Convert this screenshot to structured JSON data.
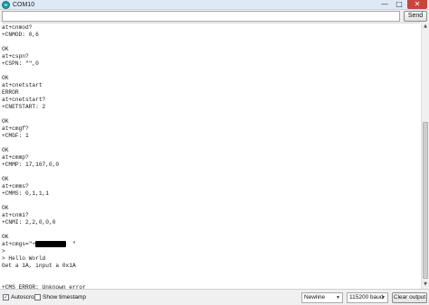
{
  "window": {
    "title": "COM10",
    "minimize_glyph": "—",
    "maximize_glyph": "□",
    "close_glyph": "✕"
  },
  "input": {
    "value": "",
    "send_label": "Send"
  },
  "output": {
    "lines": [
      "at+cnmod?",
      "+CNMOD: 0,6",
      "",
      "OK",
      "at+cspn?",
      "+CSPN: \"\",0",
      "",
      "OK",
      "at+cnetstart",
      "ERROR",
      "at+cnetstart?",
      "+CNETSTART: 2",
      "",
      "OK",
      "at+cmgf?",
      "+CMGF: 1",
      "",
      "OK",
      "at+cmmp?",
      "+CMMP: 17,167,0,0",
      "",
      "OK",
      "at+cmms?",
      "+CMMS: 0,1,1,1",
      "",
      "OK",
      "at+cnmi?",
      "+CNMI: 2,2,0,0,0",
      "",
      "OK",
      "at+cmgs=\"+1          \"",
      ">",
      "> Hello World",
      "Get a 1A, input a 0x1A",
      "",
      "",
      "+CMS ERROR: Unknown error"
    ]
  },
  "bottom": {
    "autoscroll_label": "Autoscroll",
    "autoscroll_checked": true,
    "timestamp_label": "Show timestamp",
    "timestamp_checked": false,
    "line_ending": "Newline",
    "baud": "115200 baud",
    "clear_label": "Clear output"
  },
  "icons": {
    "app": "arduino-icon",
    "scroll_up": "scroll-up-arrow-icon",
    "scroll_down": "scroll-down-arrow-icon",
    "dropdown": "chevron-down-icon"
  },
  "colors": {
    "titlebar": "#dfe8f5",
    "close_button": "#c9453b",
    "background": "#ffffff",
    "chrome": "#f0f0f0"
  }
}
